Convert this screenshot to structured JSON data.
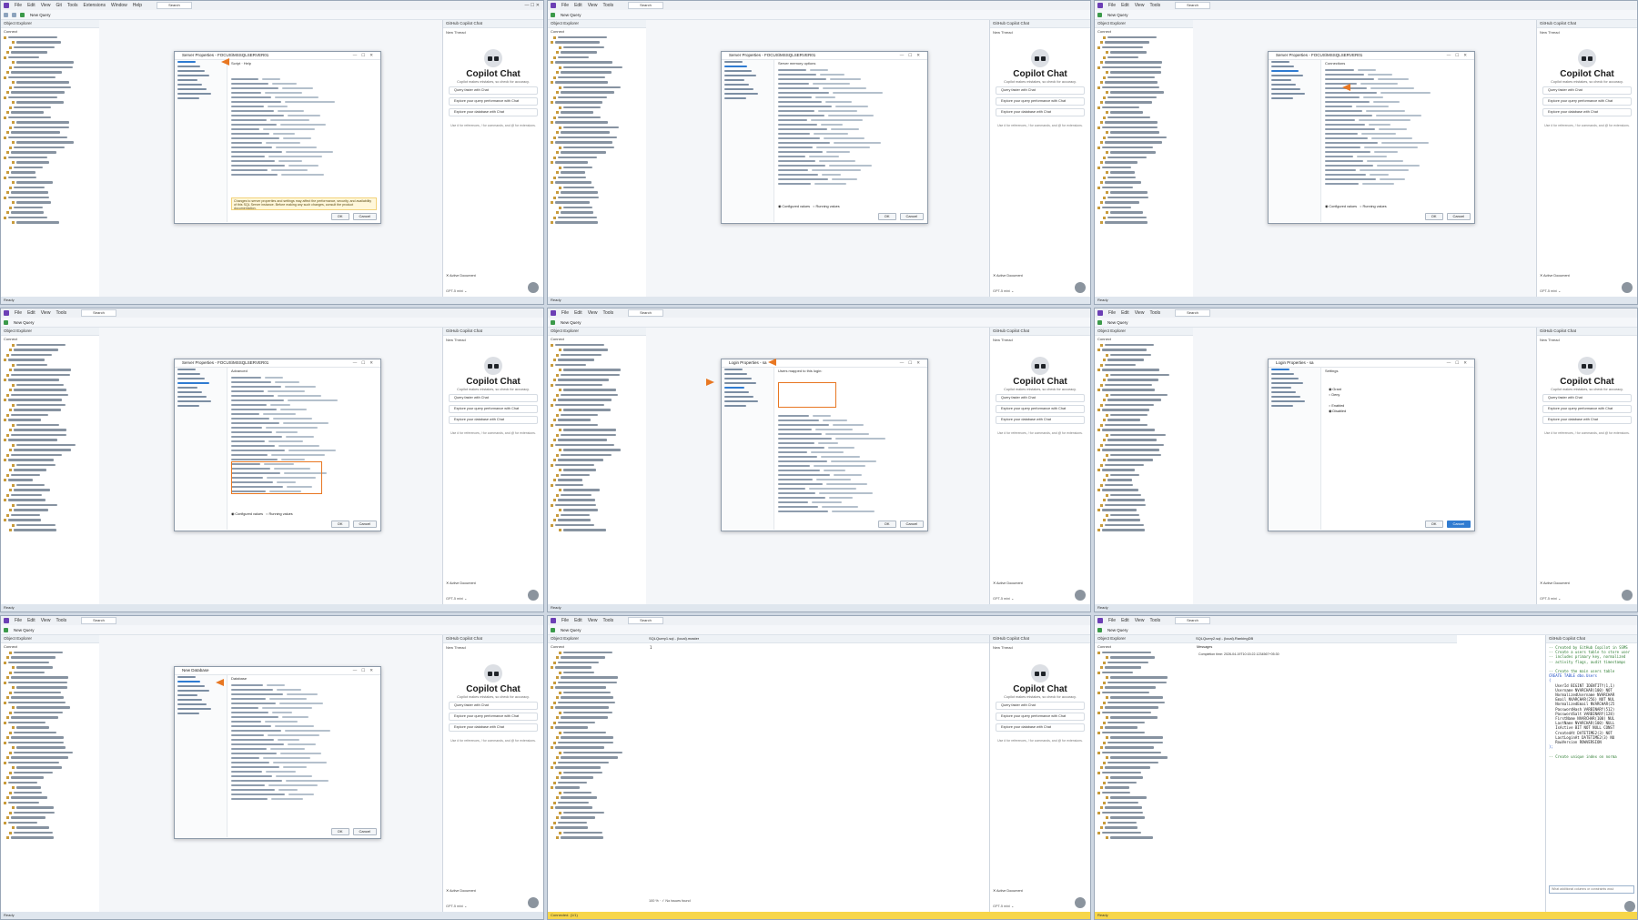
{
  "app": {
    "menu": [
      "File",
      "Edit",
      "View",
      "Git",
      "Tools",
      "Extensions",
      "Window",
      "Help"
    ],
    "search_label": "Search",
    "new_query_label": "New Query",
    "status_ready": "Ready",
    "status_repo": "Select Repository",
    "explorer_title": "Object Explorer",
    "connect_label": "Connect",
    "copilot_panel_title": "GitHub Copilot Chat",
    "new_thread_label": "New Thread"
  },
  "copilot": {
    "title": "Copilot Chat",
    "subtitle": "Copilot makes mistakes, so check for accuracy.",
    "suggestions": [
      "Query faster with Chat",
      "Explore your query performance with Chat",
      "Explore your database with Chat"
    ],
    "hint": "Use # for references, / for commands, and @ for extensions.",
    "active_document": "Active Document",
    "model": "GPT-5 mini",
    "ask": "Help what can you do?"
  },
  "tiles": [
    {
      "id": "t1",
      "dialog_title": "Server Properties - FOCUS\\MSSQLSERVER01",
      "toolbar_label": "Script",
      "help_label": "Help",
      "ok_label": "OK",
      "cancel_label": "Cancel",
      "warn_text": "Changes to server properties and settings may affect the performance, security, and availability of this SQL Server instance. Before making any such changes, consult the product documentation.",
      "name_label": "Name",
      "name_desc": "Name of the server and instance.",
      "ready_label": "Ready",
      "connection_label": "Connection",
      "progress_label": "Progress"
    },
    {
      "id": "t2",
      "dialog_title": "Server Properties - FOCUS\\MSSQLSERVER01",
      "toolbar_label": "Script",
      "help_label": "Help",
      "ok_label": "OK",
      "cancel_label": "Cancel",
      "head": "Server memory options",
      "configured_label": "Configured values",
      "running_label": "Running values"
    },
    {
      "id": "t3",
      "dialog_title": "Server Properties - FOCUS\\MSSQLSERVER01",
      "toolbar_label": "Script",
      "help_label": "Help",
      "ok_label": "OK",
      "cancel_label": "Cancel",
      "head": "Connections",
      "configured_label": "Configured values",
      "running_label": "Running values"
    },
    {
      "id": "t4",
      "dialog_title": "Server Properties - FOCUS\\MSSQLSERVER01",
      "toolbar_label": "Script",
      "help_label": "Help",
      "ok_label": "OK",
      "cancel_label": "Cancel",
      "head": "Advanced",
      "configured_label": "Configured values",
      "running_label": "Running values"
    },
    {
      "id": "t5",
      "dialog_title": "Login Properties - sa",
      "toolbar_label": "Script",
      "help_label": "Help",
      "ok_label": "OK",
      "cancel_label": "Cancel",
      "head": "Users mapped to this login:"
    },
    {
      "id": "t6",
      "dialog_title": "Login Properties - sa",
      "toolbar_label": "Script",
      "help_label": "Help",
      "ok_label": "OK",
      "cancel_label": "Cancel",
      "head": "Settings",
      "opt1": "Grant",
      "opt2": "Deny",
      "opt3": "Enabled",
      "opt4": "Disabled"
    },
    {
      "id": "t7",
      "dialog_title": "New Database",
      "toolbar_label": "Script",
      "help_label": "Help",
      "ok_label": "OK",
      "cancel_label": "Cancel",
      "head": "Database"
    },
    {
      "id": "t8",
      "tab_label": "SQLQuery1.sql - (local).master",
      "line_no": "1",
      "zoom": "100 %",
      "no_issues": "No issues found",
      "status": "Connected. (1/1)"
    },
    {
      "id": "t9",
      "tab_label": "SQLQuery2.sql - (local).RankingDB",
      "messages_label": "Messages",
      "message_text": "Completion time: 2026-04-19T10:15:22.1234567+05:30",
      "code_lines": [
        "-- Created by GitHub Copilot in SSMS",
        "-- Create a users table to store user",
        "-- includes primary key, normalized",
        "-- activity flags, audit timestamps",
        "",
        "-- Create the main users table",
        "CREATE TABLE dbo.Users",
        "(",
        "   UserId BIGINT IDENTITY(1,1)",
        "   Username NVARCHAR(100) NOT",
        "   NormalizedUsername NVARCHAR",
        "   Email NVARCHAR(256) NOT NUL",
        "   NormalizedEmail NVARCHAR(25",
        "   PasswordHash VARBINARY(512)",
        "   PasswordSalt VARBINARY(128)",
        "   FirstName NVARCHAR(100) NUL",
        "   LastName NVARCHAR(100) NULL",
        "   IsActive BIT NOT NULL CONST",
        "   CreatedAt DATETIME2(3) NOT",
        "   LastLoginAt DATETIME2(3) NU",
        "   RowVersion ROWVERSION",
        ");",
        "",
        "-- Create unique index on norma"
      ],
      "prompt_placeholder": "What additional columns or constraints woul"
    }
  ]
}
